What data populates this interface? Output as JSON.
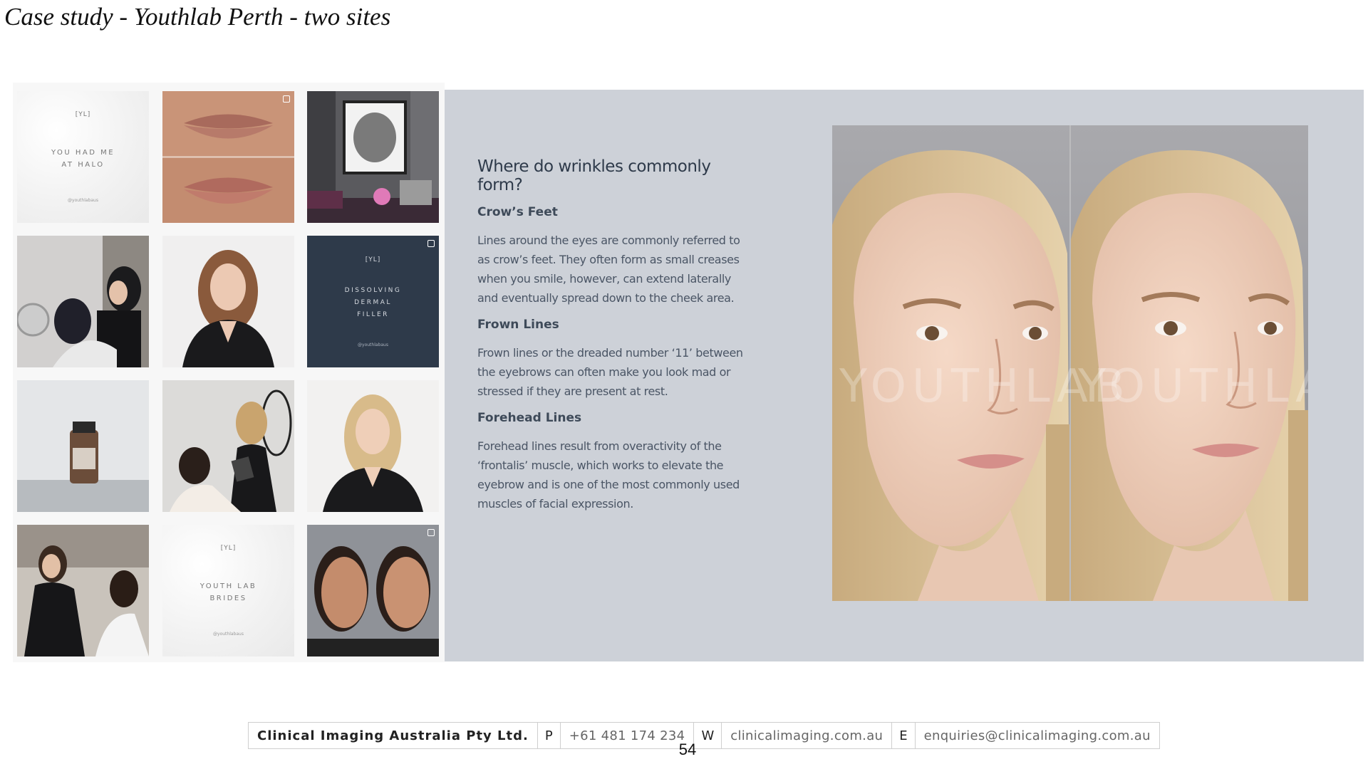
{
  "header": {
    "title": "Case study - Youthlab Perth - two sites"
  },
  "grid": {
    "card_youhadme": {
      "logo": "[YL]",
      "line1": "YOU HAD ME",
      "line2": "AT HALO",
      "handle": "@youthlabaus"
    },
    "card_dissolving": {
      "logo": "[YL]",
      "line1": "DISSOLVING",
      "line2": "DERMAL",
      "line3": "FILLER",
      "handle": "@youthlabaus"
    },
    "card_brides": {
      "logo": "[YL]",
      "line1": "YOUTH LAB",
      "line2": "BRIDES",
      "handle": "@youthlabaus"
    }
  },
  "slide": {
    "heading": "Where do wrinkles commonly form?",
    "sections": [
      {
        "title": "Crow’s Feet",
        "body": "Lines around the eyes are commonly referred to as crow’s feet. They often form as small creases when you smile, however, can extend laterally and eventually spread down to the cheek area."
      },
      {
        "title": "Frown Lines",
        "body": "Frown lines or the dreaded number ‘11’ between the eyebrows can often make you look mad or stressed if they are present at rest."
      },
      {
        "title": "Forehead Lines",
        "body": "Forehead lines result from overactivity of the ‘frontalis’ muscle, which works to elevate the eyebrow and is one of the most commonly used muscles of facial expression."
      }
    ],
    "watermark": "YOUTHLAB"
  },
  "footer": {
    "company": "Clinical Imaging Australia Pty Ltd.",
    "phone_key": "P",
    "phone": "+61 481 174 234",
    "web_key": "W",
    "web": "clinicalimaging.com.au",
    "email_key": "E",
    "email": "enquiries@clinicalimaging.com.au"
  },
  "page_number": "54"
}
